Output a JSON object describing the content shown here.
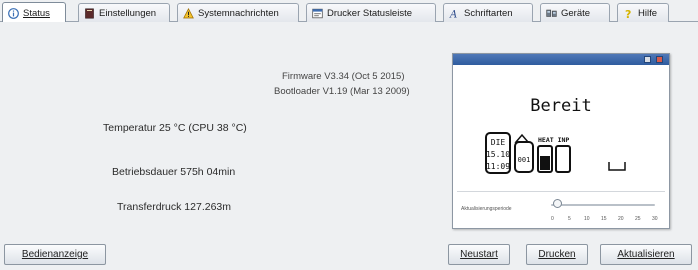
{
  "tabs": [
    {
      "label": "Status",
      "icon": "info-icon",
      "active": true
    },
    {
      "label": "Einstellungen",
      "icon": "settings-book-icon",
      "active": false
    },
    {
      "label": "Systemnachrichten",
      "icon": "warning-icon",
      "active": false
    },
    {
      "label": "Drucker Statusleiste",
      "icon": "statusbar-icon",
      "active": false
    },
    {
      "label": "Schriftarten",
      "icon": "font-icon",
      "active": false
    },
    {
      "label": "Geräte",
      "icon": "devices-icon",
      "active": false
    },
    {
      "label": "Hilfe",
      "icon": "help-icon",
      "active": false
    }
  ],
  "status": {
    "firmware": "Firmware V3.34 (Oct  5 2015)",
    "bootloader": "Bootloader V1.19 (Mar 13 2009)",
    "temperature": "Temperatur 25 °C (CPU 38 °C)",
    "operating_time": "Betriebsdauer 575h 04min",
    "transfer_print": "Transferdruck 127.263m"
  },
  "printer_display": {
    "status_text": "Bereit",
    "date_day": "DIE",
    "date_date": "15.10",
    "date_time": "11:09",
    "counter": "001",
    "head_labels": "HEAT INP",
    "slider_label": "Aktualisierungsperiode",
    "slider_value": 0,
    "slider_ticks": [
      "0",
      "5",
      "10",
      "15",
      "20",
      "25",
      "30"
    ]
  },
  "buttons": {
    "operator_panel": "Bedienanzeige",
    "restart": "Neustart",
    "print": "Drucken",
    "refresh": "Aktualisieren"
  },
  "colors": {
    "active_tab": "#ffffff",
    "panel_bg": "#eef0f2",
    "lcd_title": "#2f5c9e"
  }
}
